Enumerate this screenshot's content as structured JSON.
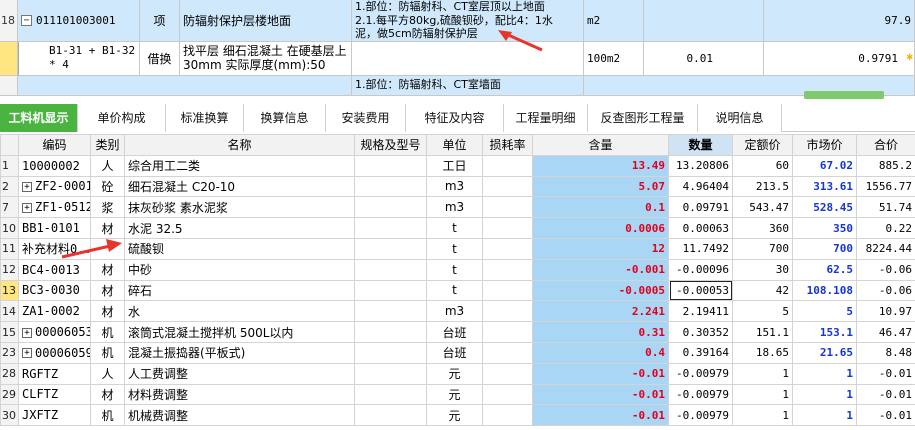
{
  "top_rows": [
    {
      "rownum": "18",
      "code": "011101003001",
      "type": "项",
      "name": "防辐射保护层楼地面",
      "desc_line1": "1.部位：防辐射科、CT室层顶以上地面",
      "desc_line2": "2.1.每平方80kg,硫酸钡砂，配比4：1水",
      "desc_line3": "泥，做5cm防辐射保护层",
      "unit": "m2",
      "value": "97.9"
    },
    {
      "rownum": "",
      "code_line1": "B1-31 + B1-32",
      "code_line2": "* 4",
      "type": "借换",
      "name_line1": "找平层 细石混凝土 在硬基层上",
      "name_line2": "30mm  实际厚度(mm):50",
      "unit": "100m2",
      "qty": "0.01",
      "value": "0.9791"
    },
    {
      "rownum": "",
      "desc": "1.部位：防辐射科、CT室墙面"
    }
  ],
  "tabs": [
    "工料机显示",
    "单价构成",
    "标准换算",
    "换算信息",
    "安装费用",
    "特征及内容",
    "工程量明细",
    "反查图形工程量",
    "说明信息"
  ],
  "columns": [
    "编码",
    "类别",
    "名称",
    "规格及型号",
    "单位",
    "损耗率",
    "含量",
    "数量",
    "定额价",
    "市场价",
    "合价"
  ],
  "rows": [
    {
      "rn": "1",
      "code": "10000002",
      "expand": false,
      "cat": "人",
      "name": "综合用工二类",
      "spec": "",
      "unit": "工日",
      "loss": "",
      "content": "13.49",
      "qty": "13.20806",
      "base": "60",
      "market": "67.02",
      "total": "885.2"
    },
    {
      "rn": "2",
      "code": "ZF2-0001",
      "expand": true,
      "cat": "砼",
      "name": "细石混凝土 C20-10",
      "spec": "",
      "unit": "m3",
      "loss": "",
      "content": "5.07",
      "qty": "4.96404",
      "base": "213.5",
      "market": "313.61",
      "total": "1556.77"
    },
    {
      "rn": "7",
      "code": "ZF1-0512",
      "expand": true,
      "cat": "浆",
      "name": "抹灰砂浆 素水泥浆",
      "spec": "",
      "unit": "m3",
      "loss": "",
      "content": "0.1",
      "qty": "0.09791",
      "base": "543.47",
      "market": "528.45",
      "total": "51.74"
    },
    {
      "rn": "10",
      "code": "BB1-0101",
      "expand": false,
      "cat": "材",
      "name": "水泥 32.5",
      "spec": "",
      "unit": "t",
      "loss": "",
      "content": "0.0006",
      "qty": "0.00063",
      "base": "360",
      "market": "350",
      "total": "0.22"
    },
    {
      "rn": "11",
      "code": "补充材料0...",
      "expand": false,
      "cat": "",
      "name": "硫酸钡",
      "spec": "",
      "unit": "t",
      "loss": "",
      "content": "12",
      "qty": "11.7492",
      "base": "700",
      "market": "700",
      "total": "8224.44"
    },
    {
      "rn": "12",
      "code": "BC4-0013",
      "expand": false,
      "cat": "材",
      "name": "中砂",
      "spec": "",
      "unit": "t",
      "loss": "",
      "content": "-0.001",
      "qty": "-0.00096",
      "base": "30",
      "market": "62.5",
      "total": "-0.06"
    },
    {
      "rn": "13",
      "code": "BC3-0030",
      "expand": false,
      "cat": "材",
      "name": "碎石",
      "spec": "",
      "unit": "t",
      "loss": "",
      "content": "-0.0005",
      "qty": "-0.00053",
      "base": "42",
      "market": "108.108",
      "total": "-0.06"
    },
    {
      "rn": "14",
      "code": "ZA1-0002",
      "expand": false,
      "cat": "材",
      "name": "水",
      "spec": "",
      "unit": "m3",
      "loss": "",
      "content": "2.241",
      "qty": "2.19411",
      "base": "5",
      "market": "5",
      "total": "10.97"
    },
    {
      "rn": "15",
      "code": "00006053",
      "expand": true,
      "cat": "机",
      "name": "滚筒式混凝土搅拌机 500L以内",
      "spec": "",
      "unit": "台班",
      "loss": "",
      "content": "0.31",
      "qty": "0.30352",
      "base": "151.1",
      "market": "153.1",
      "total": "46.47"
    },
    {
      "rn": "23",
      "code": "00006059",
      "expand": true,
      "cat": "机",
      "name": "混凝土振捣器(平板式)",
      "spec": "",
      "unit": "台班",
      "loss": "",
      "content": "0.4",
      "qty": "0.39164",
      "base": "18.65",
      "market": "21.65",
      "total": "8.48"
    },
    {
      "rn": "28",
      "code": "RGFTZ",
      "expand": false,
      "cat": "人",
      "name": "人工费调整",
      "spec": "",
      "unit": "元",
      "loss": "",
      "content": "-0.01",
      "qty": "-0.00979",
      "base": "1",
      "market": "1",
      "total": "-0.01"
    },
    {
      "rn": "29",
      "code": "CLFTZ",
      "expand": false,
      "cat": "材",
      "name": "材料费调整",
      "spec": "",
      "unit": "元",
      "loss": "",
      "content": "-0.01",
      "qty": "-0.00979",
      "base": "1",
      "market": "1",
      "total": "-0.01"
    },
    {
      "rn": "30",
      "code": "JXFTZ",
      "expand": false,
      "cat": "机",
      "name": "机械费调整",
      "spec": "",
      "unit": "元",
      "loss": "",
      "content": "-0.01",
      "qty": "-0.00979",
      "base": "1",
      "market": "1",
      "total": "-0.01"
    }
  ],
  "colors": {
    "accent": "#4bb33f",
    "highlight": "#a9d6f5",
    "red": "#e2001a",
    "blue": "#1535d6",
    "arrow": "#e8352b"
  }
}
